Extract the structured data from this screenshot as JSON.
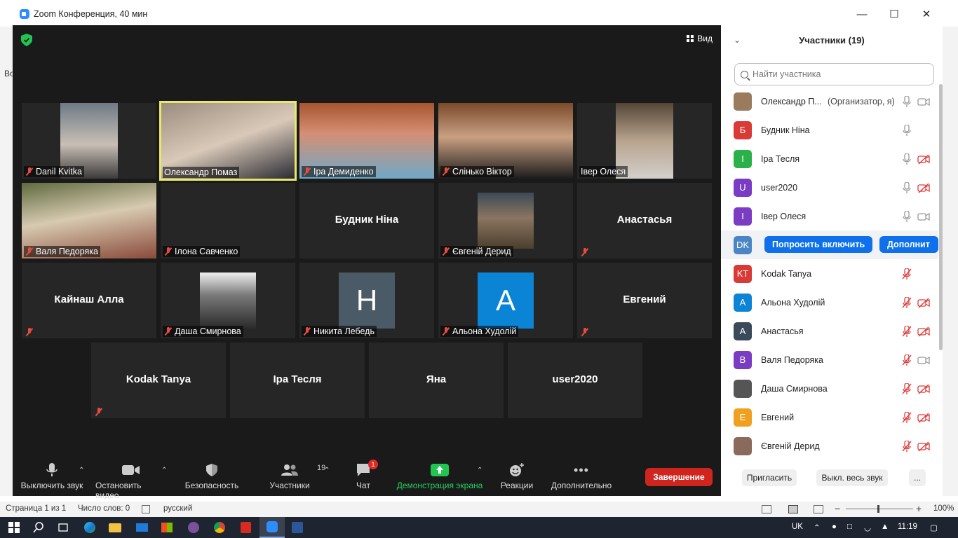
{
  "window": {
    "title": "Zoom Конференция, 40 мин"
  },
  "background_fragment": "Во",
  "video": {
    "view_label": "Вид",
    "tiles": [
      {
        "name": "Danil Kvitka",
        "muted": true,
        "display": "photo"
      },
      {
        "name": "Олександр Помаз",
        "muted": false,
        "display": "photo",
        "active_speaker": true
      },
      {
        "name": "Іра Демиденко",
        "muted": true,
        "display": "photo"
      },
      {
        "name": "Слінько Віктор",
        "muted": true,
        "display": "photo"
      },
      {
        "name": "Івер Олеся",
        "muted": false,
        "display": "photo"
      },
      {
        "name": "Валя Педоряка",
        "muted": true,
        "display": "photo"
      },
      {
        "name": "Ілона Савченко",
        "muted": true,
        "display": "off"
      },
      {
        "name": "Будник Ніна",
        "muted": false,
        "display": "name"
      },
      {
        "name": "Євгеній Дерид",
        "muted": true,
        "display": "photo"
      },
      {
        "name": "Анастасья",
        "muted": true,
        "display": "name"
      },
      {
        "name": "Кайнаш Алла",
        "muted": true,
        "display": "name"
      },
      {
        "name": "Даша Смирнова",
        "muted": true,
        "display": "photo"
      },
      {
        "name": "Никита Лебедь",
        "muted": true,
        "display": "letter",
        "letter": "Н",
        "color": "#4a5a66"
      },
      {
        "name": "Альона Худолій",
        "muted": true,
        "display": "letter",
        "letter": "А",
        "color": "#0b84d6"
      },
      {
        "name": "Евгений",
        "muted": true,
        "display": "name"
      },
      {
        "name": "Kodak Tanya",
        "muted": true,
        "display": "name"
      },
      {
        "name": "Іра Тесля",
        "muted": false,
        "display": "name"
      },
      {
        "name": "Яна",
        "muted": false,
        "display": "name"
      },
      {
        "name": "user2020",
        "muted": false,
        "display": "name"
      }
    ]
  },
  "toolbar": {
    "mute": "Выключить звук",
    "stop_video": "Остановить видео",
    "security": "Безопасность",
    "participants": "Участники",
    "participants_count": "19",
    "chat": "Чат",
    "chat_badge": "1",
    "share": "Демонстрация экрана",
    "reactions": "Реакции",
    "more": "Дополнительно",
    "end": "Завершение"
  },
  "panel": {
    "title": "Участники (19)",
    "search_placeholder": "Найти участника",
    "participants": [
      {
        "initials": "",
        "color": "#9a7b5e",
        "name": "Олександр П...",
        "role": "(Организатор, я)",
        "mic": "on",
        "cam": "on"
      },
      {
        "initials": "Б",
        "color": "#d93a35",
        "name": "Будник Ніна",
        "role": "",
        "mic": "on",
        "cam": "none"
      },
      {
        "initials": "І",
        "color": "#2ab14a",
        "name": "Іра Тесля",
        "role": "",
        "mic": "on",
        "cam": "off"
      },
      {
        "initials": "U",
        "color": "#7b3cc4",
        "name": "user2020",
        "role": "",
        "mic": "on",
        "cam": "off"
      },
      {
        "initials": "І",
        "color": "#7b3cc4",
        "name": "Івер Олеся",
        "role": "",
        "mic": "on",
        "cam": "on"
      },
      {
        "initials": "DK",
        "color": "#4a86c5",
        "name": "",
        "role": "",
        "mic": "none",
        "cam": "none",
        "hover": true,
        "ask_label": "Попросить включить",
        "more_label": "Дополнит"
      },
      {
        "initials": "KT",
        "color": "#d93a35",
        "name": "Kodak Tanya",
        "role": "",
        "mic": "off",
        "cam": "none"
      },
      {
        "initials": "А",
        "color": "#0b84d6",
        "name": "Альона Худолій",
        "role": "",
        "mic": "off",
        "cam": "off"
      },
      {
        "initials": "А",
        "color": "#3a4a5a",
        "name": "Анастасья",
        "role": "",
        "mic": "off",
        "cam": "off"
      },
      {
        "initials": "В",
        "color": "#7b3cc4",
        "name": "Валя Педоряка",
        "role": "",
        "mic": "off",
        "cam": "on"
      },
      {
        "initials": "",
        "color": "#555555",
        "name": "Даша Смирнова",
        "role": "",
        "mic": "off",
        "cam": "off"
      },
      {
        "initials": "Е",
        "color": "#f0a020",
        "name": "Евгений",
        "role": "",
        "mic": "off",
        "cam": "off"
      },
      {
        "initials": "",
        "color": "#8a6a5a",
        "name": "Євгеній Дерид",
        "role": "",
        "mic": "off",
        "cam": "off"
      }
    ],
    "invite": "Пригласить",
    "mute_all": "Выкл. весь звук",
    "more": "..."
  },
  "statusbar": {
    "page": "Страница 1 из 1",
    "words": "Число слов: 0",
    "language": "русский",
    "zoom": "100%"
  },
  "taskbar": {
    "lang": "UK",
    "time": "11:19"
  }
}
